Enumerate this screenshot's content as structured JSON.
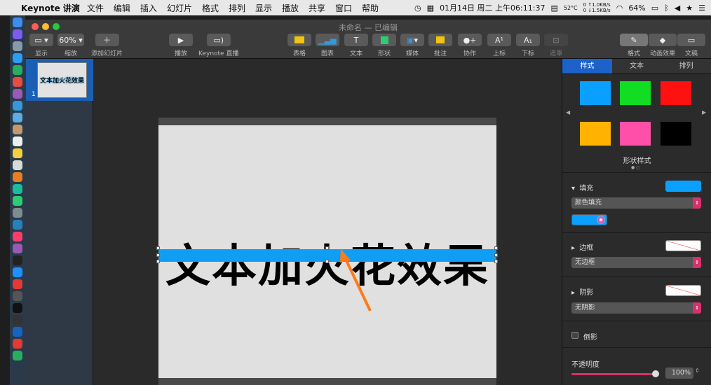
{
  "menubar": {
    "app_name": "Keynote 讲演",
    "items": [
      "文件",
      "编辑",
      "插入",
      "幻灯片",
      "格式",
      "排列",
      "显示",
      "播放",
      "共享",
      "窗口",
      "帮助"
    ],
    "datetime": "01月14日 周二 上午06:11:37",
    "temperature": "52°C",
    "net_up": "0 ↑1.0KB/s",
    "net_down": "0 ↓1.5KB/s",
    "battery": "64%"
  },
  "window": {
    "title": "未命名 — 已编辑",
    "colors": {
      "close": "#ff5f57",
      "minimize": "#febc2e",
      "zoom": "#28c840"
    }
  },
  "toolbar": {
    "view_label": "显示",
    "zoom_value": "60%",
    "zoom_label": "缩放",
    "add_slide_label": "添加幻灯片",
    "play_label": "播放",
    "live_label": "Keynote 直播",
    "table_label": "表格",
    "chart_label": "图表",
    "text_label": "文本",
    "shape_label": "形状",
    "media_label": "媒体",
    "comment_label": "批注",
    "collab_label": "协作",
    "superscript_label": "上标",
    "subscript_label": "下标",
    "mask_label": "遮罩",
    "format_label": "格式",
    "animate_label": "动画效果",
    "document_label": "文稿"
  },
  "navigator": {
    "slide_number": "1",
    "thumb_text": "文本加火花效果"
  },
  "slide": {
    "text": "文本加火花效果",
    "bar_color": "#109ef5"
  },
  "inspector": {
    "tabs": [
      "样式",
      "文本",
      "排列"
    ],
    "active_tab": "样式",
    "swatches": [
      "#0aa0ff",
      "#11dd22",
      "#ff1111",
      "#ffb300",
      "#ff4fa8",
      "#000000"
    ],
    "shape_style_label": "形状样式",
    "fill_label": "填充",
    "fill_color": "#0aa0ff",
    "fill_type": "颜色填充",
    "border_label": "边框",
    "border_type": "无边框",
    "shadow_label": "阴影",
    "shadow_type": "无阴影",
    "reflection_label": "倒影",
    "opacity_label": "不透明度",
    "opacity_value": "100%",
    "opacity_fraction": 1.0
  }
}
